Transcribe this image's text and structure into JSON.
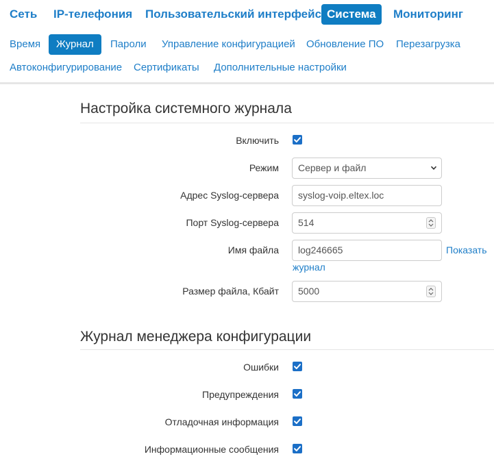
{
  "nav_main": [
    "Сеть",
    "IP-телефония",
    "Пользовательский интерфейс",
    "Система",
    "Мониторинг"
  ],
  "nav_sub": [
    "Время",
    "Журнал",
    "Пароли",
    "Управление конфигурацией",
    "Обновление ПО",
    "Перезагрузка",
    "Автоконфигурирование",
    "Сертификаты",
    "Дополнительные настройки"
  ],
  "active_main": "Система",
  "active_sub": "Журнал",
  "syslog": {
    "title": "Настройка системного журнала",
    "enable_label": "Включить",
    "enable_checked": true,
    "mode_label": "Режим",
    "mode_value": "Сервер и файл",
    "server_label": "Адрес Syslog-сервера",
    "server_value": "syslog-voip.eltex.loc",
    "port_label": "Порт Syslog-сервера",
    "port_value": "514",
    "file_label": "Имя файла",
    "file_value": "log246665",
    "show_log_word1": "Показать",
    "show_log_word2": "журнал",
    "size_label": "Размер файла, Кбайт",
    "size_value": "5000"
  },
  "config_log": {
    "title": "Журнал менеджера конфигурации",
    "errors_label": "Ошибки",
    "errors_checked": true,
    "warnings_label": "Предупреждения",
    "warnings_checked": true,
    "debug_label": "Отладочная информация",
    "debug_checked": true,
    "info_label": "Информационные сообщения",
    "info_checked": true
  },
  "colors": {
    "accent": "#0f7dc2",
    "link": "#1e7ec8",
    "checkbox": "#1b6fc7"
  }
}
